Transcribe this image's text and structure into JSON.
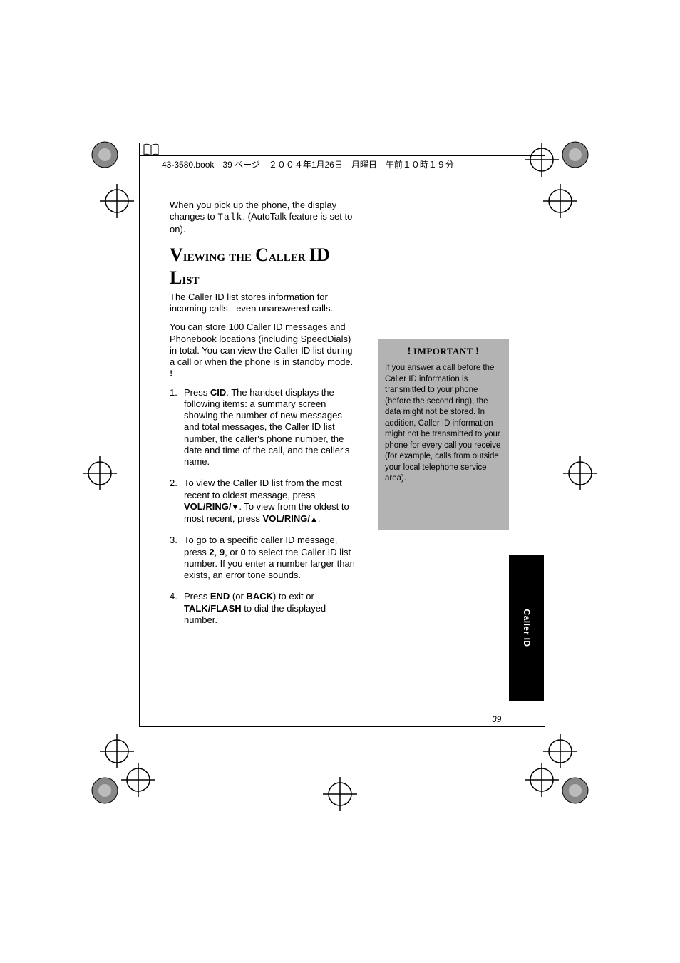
{
  "header": "43-3580.book　39 ページ　２００４年1月26日　月曜日　午前１０時１９分",
  "intro": {
    "p1a": "When you pick up the phone, the display changes to ",
    "p1mono": "Talk",
    "p1b": ". (AutoTalk feature is set to on)."
  },
  "heading": "Viewing the Caller ID List",
  "body": {
    "p1": "The Caller ID list stores information for incoming calls - even unanswered calls.",
    "p2a": "You can store 100 Caller ID messages and Phonebook locations (including SpeedDials) in total. You can view the Caller ID list during a call or when the phone is in standby mode. "
  },
  "steps": [
    {
      "num": "1.",
      "a": "Press ",
      "b1": "CID",
      "c": ". The handset displays the following items: a summary screen showing the number of new messages and total messages, the Caller ID list number, the caller's phone number, the date and time of the call, and the caller's name."
    },
    {
      "num": "2.",
      "a": "To view the Caller ID list from the most recent to oldest message, press ",
      "b1": "VOL/RING/",
      "arrow1": "▼",
      "c": ". To view from the oldest to most recent, press ",
      "b2": "VOL/RING/",
      "arrow2": "▲",
      "d": "."
    },
    {
      "num": "3.",
      "a": "To go to a specific caller ID message, press ",
      "b1": "2",
      "c": ", ",
      "b2": "9",
      "d": ", or ",
      "b3": "0",
      "e": " to select the Caller ID list number. If you enter a number larger than exists, an error tone sounds."
    },
    {
      "num": "4.",
      "a": "Press ",
      "b1": "END",
      "c": " (or ",
      "b2": "BACK",
      "d": ") to exit or ",
      "b3": "TALK/FLASH",
      "e": " to dial the displayed number."
    }
  ],
  "important": {
    "title": "IMPORTANT",
    "text": "If you answer a call before the Caller ID information is transmitted to your phone (before the second ring), the data might not be stored. In addition, Caller ID information might not be transmitted to your phone for every call you receive (for example, calls from outside your local telephone service area)."
  },
  "tab": "Caller ID",
  "page_number": "39"
}
